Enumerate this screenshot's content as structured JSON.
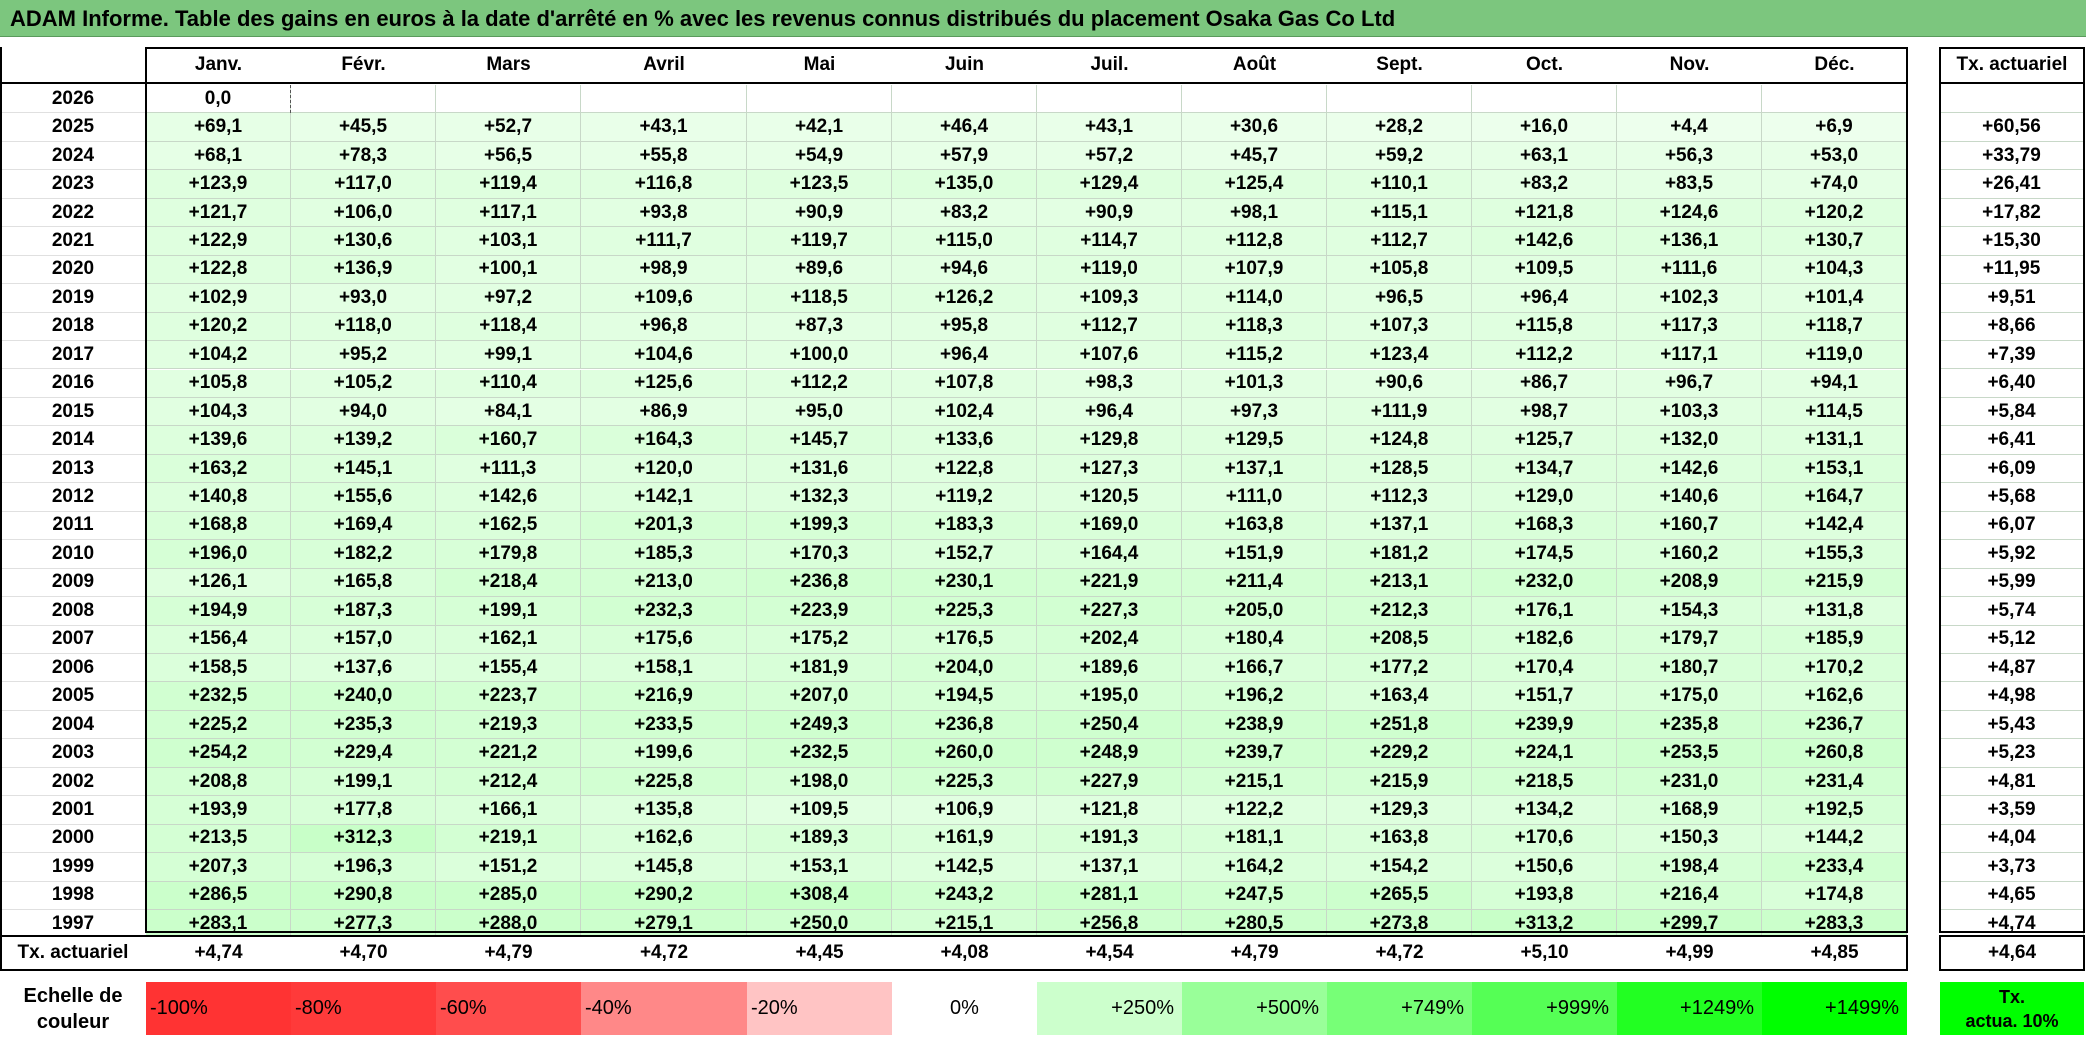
{
  "title": "ADAM Informe. Table des gains en euros à la date d'arrêté en % avec les revenus connus distribués du placement Osaka Gas Co Ltd",
  "months": [
    "Janv.",
    "Févr.",
    "Mars",
    "Avril",
    "Mai",
    "Juin",
    "Juil.",
    "Août",
    "Sept.",
    "Oct.",
    "Nov.",
    "Déc."
  ],
  "actuarial_header": "Tx. actuariel",
  "rows": [
    {
      "year": "2026",
      "values": [
        "0,0",
        "",
        "",
        "",
        "",
        "",
        "",
        "",
        "",
        "",
        "",
        ""
      ],
      "rate": ""
    },
    {
      "year": "2025",
      "values": [
        "+69,1",
        "+45,5",
        "+52,7",
        "+43,1",
        "+42,1",
        "+46,4",
        "+43,1",
        "+30,6",
        "+28,2",
        "+16,0",
        "+4,4",
        "+6,9"
      ],
      "rate": "+60,56"
    },
    {
      "year": "2024",
      "values": [
        "+68,1",
        "+78,3",
        "+56,5",
        "+55,8",
        "+54,9",
        "+57,9",
        "+57,2",
        "+45,7",
        "+59,2",
        "+63,1",
        "+56,3",
        "+53,0"
      ],
      "rate": "+33,79"
    },
    {
      "year": "2023",
      "values": [
        "+123,9",
        "+117,0",
        "+119,4",
        "+116,8",
        "+123,5",
        "+135,0",
        "+129,4",
        "+125,4",
        "+110,1",
        "+83,2",
        "+83,5",
        "+74,0"
      ],
      "rate": "+26,41"
    },
    {
      "year": "2022",
      "values": [
        "+121,7",
        "+106,0",
        "+117,1",
        "+93,8",
        "+90,9",
        "+83,2",
        "+90,9",
        "+98,1",
        "+115,1",
        "+121,8",
        "+124,6",
        "+120,2"
      ],
      "rate": "+17,82"
    },
    {
      "year": "2021",
      "values": [
        "+122,9",
        "+130,6",
        "+103,1",
        "+111,7",
        "+119,7",
        "+115,0",
        "+114,7",
        "+112,8",
        "+112,7",
        "+142,6",
        "+136,1",
        "+130,7"
      ],
      "rate": "+15,30"
    },
    {
      "year": "2020",
      "values": [
        "+122,8",
        "+136,9",
        "+100,1",
        "+98,9",
        "+89,6",
        "+94,6",
        "+119,0",
        "+107,9",
        "+105,8",
        "+109,5",
        "+111,6",
        "+104,3"
      ],
      "rate": "+11,95"
    },
    {
      "year": "2019",
      "values": [
        "+102,9",
        "+93,0",
        "+97,2",
        "+109,6",
        "+118,5",
        "+126,2",
        "+109,3",
        "+114,0",
        "+96,5",
        "+96,4",
        "+102,3",
        "+101,4"
      ],
      "rate": "+9,51"
    },
    {
      "year": "2018",
      "values": [
        "+120,2",
        "+118,0",
        "+118,4",
        "+96,8",
        "+87,3",
        "+95,8",
        "+112,7",
        "+118,3",
        "+107,3",
        "+115,8",
        "+117,3",
        "+118,7"
      ],
      "rate": "+8,66"
    },
    {
      "year": "2017",
      "values": [
        "+104,2",
        "+95,2",
        "+99,1",
        "+104,6",
        "+100,0",
        "+96,4",
        "+107,6",
        "+115,2",
        "+123,4",
        "+112,2",
        "+117,1",
        "+119,0"
      ],
      "rate": "+7,39"
    },
    {
      "year": "2016",
      "values": [
        "+105,8",
        "+105,2",
        "+110,4",
        "+125,6",
        "+112,2",
        "+107,8",
        "+98,3",
        "+101,3",
        "+90,6",
        "+86,7",
        "+96,7",
        "+94,1"
      ],
      "rate": "+6,40"
    },
    {
      "year": "2015",
      "values": [
        "+104,3",
        "+94,0",
        "+84,1",
        "+86,9",
        "+95,0",
        "+102,4",
        "+96,4",
        "+97,3",
        "+111,9",
        "+98,7",
        "+103,3",
        "+114,5"
      ],
      "rate": "+5,84"
    },
    {
      "year": "2014",
      "values": [
        "+139,6",
        "+139,2",
        "+160,7",
        "+164,3",
        "+145,7",
        "+133,6",
        "+129,8",
        "+129,5",
        "+124,8",
        "+125,7",
        "+132,0",
        "+131,1"
      ],
      "rate": "+6,41"
    },
    {
      "year": "2013",
      "values": [
        "+163,2",
        "+145,1",
        "+111,3",
        "+120,0",
        "+131,6",
        "+122,8",
        "+127,3",
        "+137,1",
        "+128,5",
        "+134,7",
        "+142,6",
        "+153,1"
      ],
      "rate": "+6,09"
    },
    {
      "year": "2012",
      "values": [
        "+140,8",
        "+155,6",
        "+142,6",
        "+142,1",
        "+132,3",
        "+119,2",
        "+120,5",
        "+111,0",
        "+112,3",
        "+129,0",
        "+140,6",
        "+164,7"
      ],
      "rate": "+5,68"
    },
    {
      "year": "2011",
      "values": [
        "+168,8",
        "+169,4",
        "+162,5",
        "+201,3",
        "+199,3",
        "+183,3",
        "+169,0",
        "+163,8",
        "+137,1",
        "+168,3",
        "+160,7",
        "+142,4"
      ],
      "rate": "+6,07"
    },
    {
      "year": "2010",
      "values": [
        "+196,0",
        "+182,2",
        "+179,8",
        "+185,3",
        "+170,3",
        "+152,7",
        "+164,4",
        "+151,9",
        "+181,2",
        "+174,5",
        "+160,2",
        "+155,3"
      ],
      "rate": "+5,92"
    },
    {
      "year": "2009",
      "values": [
        "+126,1",
        "+165,8",
        "+218,4",
        "+213,0",
        "+236,8",
        "+230,1",
        "+221,9",
        "+211,4",
        "+213,1",
        "+232,0",
        "+208,9",
        "+215,9"
      ],
      "rate": "+5,99"
    },
    {
      "year": "2008",
      "values": [
        "+194,9",
        "+187,3",
        "+199,1",
        "+232,3",
        "+223,9",
        "+225,3",
        "+227,3",
        "+205,0",
        "+212,3",
        "+176,1",
        "+154,3",
        "+131,8"
      ],
      "rate": "+5,74"
    },
    {
      "year": "2007",
      "values": [
        "+156,4",
        "+157,0",
        "+162,1",
        "+175,6",
        "+175,2",
        "+176,5",
        "+202,4",
        "+180,4",
        "+208,5",
        "+182,6",
        "+179,7",
        "+185,9"
      ],
      "rate": "+5,12"
    },
    {
      "year": "2006",
      "values": [
        "+158,5",
        "+137,6",
        "+155,4",
        "+158,1",
        "+181,9",
        "+204,0",
        "+189,6",
        "+166,7",
        "+177,2",
        "+170,4",
        "+180,7",
        "+170,2"
      ],
      "rate": "+4,87"
    },
    {
      "year": "2005",
      "values": [
        "+232,5",
        "+240,0",
        "+223,7",
        "+216,9",
        "+207,0",
        "+194,5",
        "+195,0",
        "+196,2",
        "+163,4",
        "+151,7",
        "+175,0",
        "+162,6"
      ],
      "rate": "+4,98"
    },
    {
      "year": "2004",
      "values": [
        "+225,2",
        "+235,3",
        "+219,3",
        "+233,5",
        "+249,3",
        "+236,8",
        "+250,4",
        "+238,9",
        "+251,8",
        "+239,9",
        "+235,8",
        "+236,7"
      ],
      "rate": "+5,43"
    },
    {
      "year": "2003",
      "values": [
        "+254,2",
        "+229,4",
        "+221,2",
        "+199,6",
        "+232,5",
        "+260,0",
        "+248,9",
        "+239,7",
        "+229,2",
        "+224,1",
        "+253,5",
        "+260,8"
      ],
      "rate": "+5,23"
    },
    {
      "year": "2002",
      "values": [
        "+208,8",
        "+199,1",
        "+212,4",
        "+225,8",
        "+198,0",
        "+225,3",
        "+227,9",
        "+215,1",
        "+215,9",
        "+218,5",
        "+231,0",
        "+231,4"
      ],
      "rate": "+4,81"
    },
    {
      "year": "2001",
      "values": [
        "+193,9",
        "+177,8",
        "+166,1",
        "+135,8",
        "+109,5",
        "+106,9",
        "+121,8",
        "+122,2",
        "+129,3",
        "+134,2",
        "+168,9",
        "+192,5"
      ],
      "rate": "+3,59"
    },
    {
      "year": "2000",
      "values": [
        "+213,5",
        "+312,3",
        "+219,1",
        "+162,6",
        "+189,3",
        "+161,9",
        "+191,3",
        "+181,1",
        "+163,8",
        "+170,6",
        "+150,3",
        "+144,2"
      ],
      "rate": "+4,04"
    },
    {
      "year": "1999",
      "values": [
        "+207,3",
        "+196,3",
        "+151,2",
        "+145,8",
        "+153,1",
        "+142,5",
        "+137,1",
        "+164,2",
        "+154,2",
        "+150,6",
        "+198,4",
        "+233,4"
      ],
      "rate": "+3,73"
    },
    {
      "year": "1998",
      "values": [
        "+286,5",
        "+290,8",
        "+285,0",
        "+290,2",
        "+308,4",
        "+243,2",
        "+281,1",
        "+247,5",
        "+265,5",
        "+193,8",
        "+216,4",
        "+174,8"
      ],
      "rate": "+4,65"
    },
    {
      "year": "1997",
      "values": [
        "+283,1",
        "+277,3",
        "+288,0",
        "+279,1",
        "+250,0",
        "+215,1",
        "+256,8",
        "+280,5",
        "+273,8",
        "+313,2",
        "+299,7",
        "+283,3"
      ],
      "rate": "+4,74"
    }
  ],
  "footer": {
    "label": "Tx. actuariel",
    "values": [
      "+4,74",
      "+4,70",
      "+4,79",
      "+4,72",
      "+4,45",
      "+4,08",
      "+4,54",
      "+4,79",
      "+4,72",
      "+5,10",
      "+4,99",
      "+4,85"
    ],
    "total": "+4,64"
  },
  "scale": {
    "label_line1": "Echelle de",
    "label_line2": "couleur",
    "steps": [
      {
        "text": "-100%",
        "color": "#ff3333",
        "align": "left"
      },
      {
        "text": "-80%",
        "color": "#ff3a3a",
        "align": "left"
      },
      {
        "text": "-60%",
        "color": "#ff4d4d",
        "align": "left"
      },
      {
        "text": "-40%",
        "color": "#ff8888",
        "align": "left"
      },
      {
        "text": "-20%",
        "color": "#ffc4c4",
        "align": "left"
      },
      {
        "text": "0%",
        "color": "#ffffff",
        "align": "center"
      },
      {
        "text": "+250%",
        "color": "#ccffcc",
        "align": "right"
      },
      {
        "text": "+500%",
        "color": "#99ff99",
        "align": "right"
      },
      {
        "text": "+749%",
        "color": "#77ff77",
        "align": "right"
      },
      {
        "text": "+999%",
        "color": "#55ff55",
        "align": "right"
      },
      {
        "text": "+1249%",
        "color": "#22ff22",
        "align": "right"
      },
      {
        "text": "+1499%",
        "color": "#00ff00",
        "align": "right"
      }
    ],
    "actuarial_line1": "Tx.",
    "actuarial_line2": "actua. 10%",
    "actuarial_color": "#00ff00"
  }
}
